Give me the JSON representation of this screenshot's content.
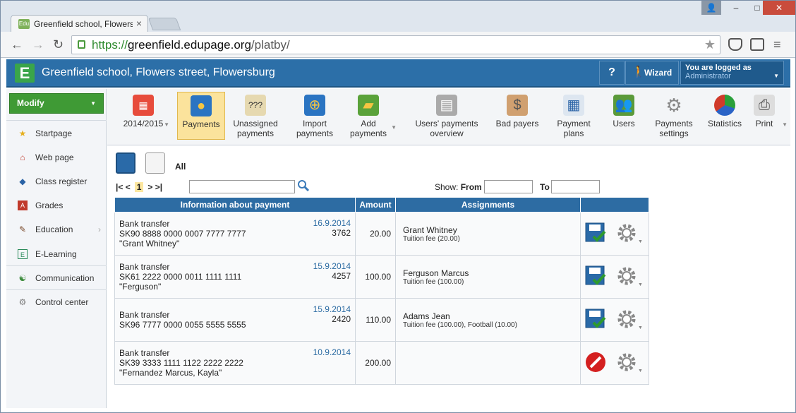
{
  "browser": {
    "tab_title": "Greenfield school, Flowers",
    "favicon_text": "Edu",
    "url_scheme": "https://",
    "url_domain": "greenfield.edupage.org",
    "url_path": "/platby/"
  },
  "header": {
    "logo": "E",
    "school_name": "Greenfield school, Flowers street, Flowersburg",
    "help_label": "?",
    "wizard_label": "Wizard",
    "logged_as_label": "You are logged as",
    "user": "Administrator"
  },
  "sidebar": {
    "modify_label": "Modify",
    "items": [
      {
        "label": "Startpage",
        "icon": "star-icon"
      },
      {
        "label": "Web page",
        "icon": "home-icon"
      },
      {
        "label": "Class register",
        "icon": "book-icon"
      },
      {
        "label": "Grades",
        "icon": "grades-icon"
      },
      {
        "label": "Education",
        "icon": "education-icon"
      },
      {
        "label": "E-Learning",
        "icon": "elearning-icon"
      },
      {
        "label": "Communication",
        "icon": "communication-icon"
      },
      {
        "label": "Control center",
        "icon": "control-center-icon"
      }
    ]
  },
  "toolbar": {
    "year": "2014/2015",
    "payments": "Payments",
    "unassigned_1": "Unassigned",
    "unassigned_2": "payments",
    "import_1": "Import",
    "import_2": "payments",
    "add_1": "Add",
    "add_2": "payments",
    "overview_1": "Users' payments",
    "overview_2": "overview",
    "bad_payers": "Bad payers",
    "plans_1": "Payment",
    "plans_2": "plans",
    "users": "Users",
    "settings_1": "Payments",
    "settings_2": "settings",
    "statistics": "Statistics",
    "print": "Print"
  },
  "filters": {
    "all_label": "All",
    "pager_first": "|< <",
    "pager_page": "1",
    "pager_last": "> >|",
    "show_label": "Show:",
    "from_label": "From",
    "to_label": "To"
  },
  "table": {
    "headers": [
      "Information about payment",
      "Amount",
      "Assignments",
      ""
    ],
    "rows": [
      {
        "type": "Bank transfer",
        "account": "SK90 8888 0000 0007 7777 7777",
        "note": "\"Grant Whitney\"",
        "date": "16.9.2014",
        "ref": "3762",
        "amount": "20.00",
        "name": "Grant Whitney",
        "detail": "Tuition fee (20.00)",
        "status": "assigned"
      },
      {
        "type": "Bank transfer",
        "account": "SK61 2222 0000 0011 1111 1111",
        "note": "\"Ferguson\"",
        "date": "15.9.2014",
        "ref": "4257",
        "amount": "100.00",
        "name": "Ferguson Marcus",
        "detail": "Tuition fee (100.00)",
        "status": "assigned"
      },
      {
        "type": "Bank transfer",
        "account": "SK96 7777 0000 0055 5555 5555",
        "note": "",
        "date": "15.9.2014",
        "ref": "2420",
        "amount": "110.00",
        "name": "Adams Jean",
        "detail": "Tuition fee (100.00), Football (10.00)",
        "status": "assigned"
      },
      {
        "type": "Bank transfer",
        "account": "SK39 3333 1111 1122 2222 2222",
        "note": "\"Fernandez Marcus, Kayla\"",
        "date": "10.9.2014",
        "ref": "",
        "amount": "200.00",
        "name": "",
        "detail": "",
        "status": "unassigned"
      }
    ]
  },
  "colors": {
    "brand_blue": "#2c6fa8",
    "modify_green": "#3f9a35",
    "active_tab": "#fbe39c"
  }
}
